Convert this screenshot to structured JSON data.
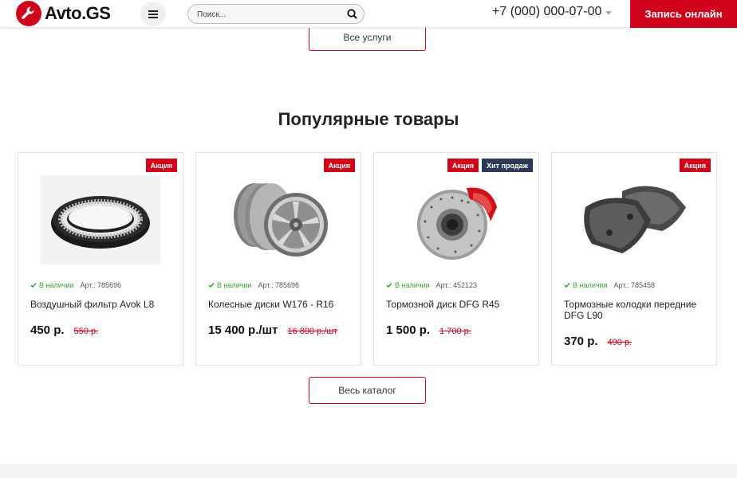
{
  "header": {
    "logo_text": "Avto.GS",
    "search_placeholder": "Поиск...",
    "phone": "+7 (000) 000-07-00",
    "cta_label": "Запись онлайн"
  },
  "services_button": "Все услуги",
  "section_title": "Популярные товары",
  "catalog_button": "Весь каталог",
  "products": [
    {
      "badges": [
        "Акция"
      ],
      "stock": "В наличии",
      "sku": "Арт.: 785696",
      "name": "Воздушный фильтр Avok L8",
      "price": "450 р.",
      "old_price": "550 р.",
      "image": "air-filter-image"
    },
    {
      "badges": [
        "Акция"
      ],
      "stock": "В наличии",
      "sku": "Арт.: 785696",
      "name": "Колесные диски W176 - R16",
      "price": "15 400 р./шт",
      "old_price": "16 800 р./шт",
      "image": "wheel-rims-image"
    },
    {
      "badges": [
        "Акция",
        "Хит продаж"
      ],
      "stock": "В наличии",
      "sku": "Арт.: 452123",
      "name": "Тормозной диск DFG R45",
      "price": "1 500 р.",
      "old_price": "1 700 р.",
      "image": "brake-disc-image"
    },
    {
      "badges": [
        "Акция"
      ],
      "stock": "В наличии",
      "sku": "Арт.: 785458",
      "name": "Тормозные колодки передние DFG L90",
      "price": "370 р.",
      "old_price": "490 р.",
      "image": "brake-pads-image"
    }
  ],
  "colors": {
    "accent": "#d0021b",
    "hit_badge": "#2b3a55",
    "in_stock": "#3aa53a"
  }
}
